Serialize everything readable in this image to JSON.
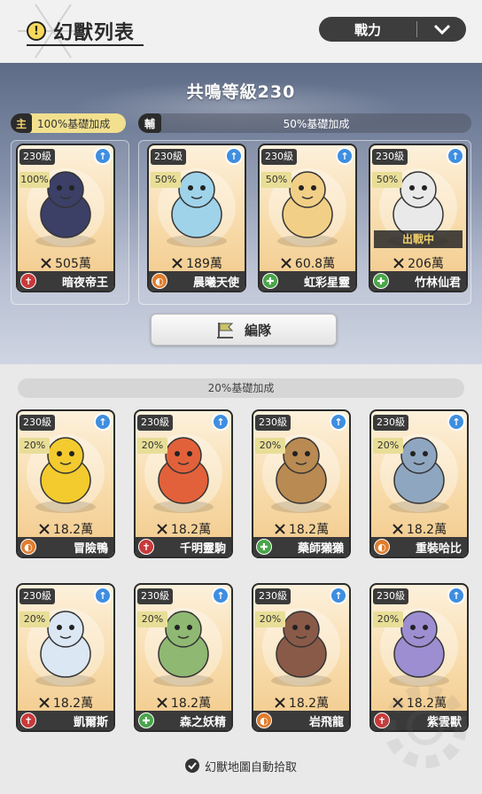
{
  "header": {
    "info_icon": "!",
    "title": "幻獸列表",
    "sort": {
      "selected": "戰力",
      "icon": "chevron-down-icon"
    }
  },
  "resonance": {
    "title": "共鳴等級230",
    "main_tag": "主",
    "main_bonus": "100%基礎加成",
    "sub_tag": "輔",
    "sub_bonus": "50%基礎加成"
  },
  "formation_button": "編隊",
  "base_bonus_band": "20%基礎加成",
  "main_cards": [
    {
      "level": "230級",
      "percent": "100%",
      "power": "505萬",
      "name": "暗夜帝王",
      "class": "attack",
      "class_symbol": "✝",
      "art_color": "#3c3f66",
      "in_battle": ""
    }
  ],
  "sub_cards": [
    {
      "level": "230級",
      "percent": "50%",
      "power": "189萬",
      "name": "晨曦天使",
      "class": "defense",
      "class_symbol": "◐",
      "art_color": "#9fd3ea",
      "in_battle": ""
    },
    {
      "level": "230級",
      "percent": "50%",
      "power": "60.8萬",
      "name": "虹彩星靈",
      "class": "support",
      "class_symbol": "✚",
      "art_color": "#f2cf86",
      "in_battle": ""
    },
    {
      "level": "230級",
      "percent": "50%",
      "power": "206萬",
      "name": "竹林仙君",
      "class": "support",
      "class_symbol": "✚",
      "art_color": "#e9e9e9",
      "in_battle": "出戰中"
    }
  ],
  "other_cards": [
    {
      "level": "230級",
      "percent": "20%",
      "power": "18.2萬",
      "name": "冒險鴨",
      "class": "defense",
      "class_symbol": "◐",
      "art_color": "#f3cb2e"
    },
    {
      "level": "230級",
      "percent": "20%",
      "power": "18.2萬",
      "name": "千明靈駒",
      "class": "attack",
      "class_symbol": "✝",
      "art_color": "#e2613a"
    },
    {
      "level": "230級",
      "percent": "20%",
      "power": "18.2萬",
      "name": "藥師獺獺",
      "class": "support",
      "class_symbol": "✚",
      "art_color": "#b98a52"
    },
    {
      "level": "230級",
      "percent": "20%",
      "power": "18.2萬",
      "name": "重裝哈比",
      "class": "defense",
      "class_symbol": "◐",
      "art_color": "#8fa6c1"
    },
    {
      "level": "230級",
      "percent": "20%",
      "power": "18.2萬",
      "name": "凱爾斯",
      "class": "attack",
      "class_symbol": "✝",
      "art_color": "#dbe7f3"
    },
    {
      "level": "230級",
      "percent": "20%",
      "power": "18.2萬",
      "name": "森之妖精",
      "class": "support",
      "class_symbol": "✚",
      "art_color": "#8fb873"
    },
    {
      "level": "230級",
      "percent": "20%",
      "power": "18.2萬",
      "name": "岩飛龍",
      "class": "defense",
      "class_symbol": "◐",
      "art_color": "#8a5a48"
    },
    {
      "level": "230級",
      "percent": "20%",
      "power": "18.2萬",
      "name": "紫雲獸",
      "class": "attack",
      "class_symbol": "✝",
      "art_color": "#9c8ed1"
    }
  ],
  "footer": {
    "auto_pick": "幻獸地圖自動拾取"
  },
  "colors": {
    "accent_gold": "#f2e08f",
    "dark": "#3a3a3a",
    "upgrade_blue": "#3f8ee0"
  }
}
